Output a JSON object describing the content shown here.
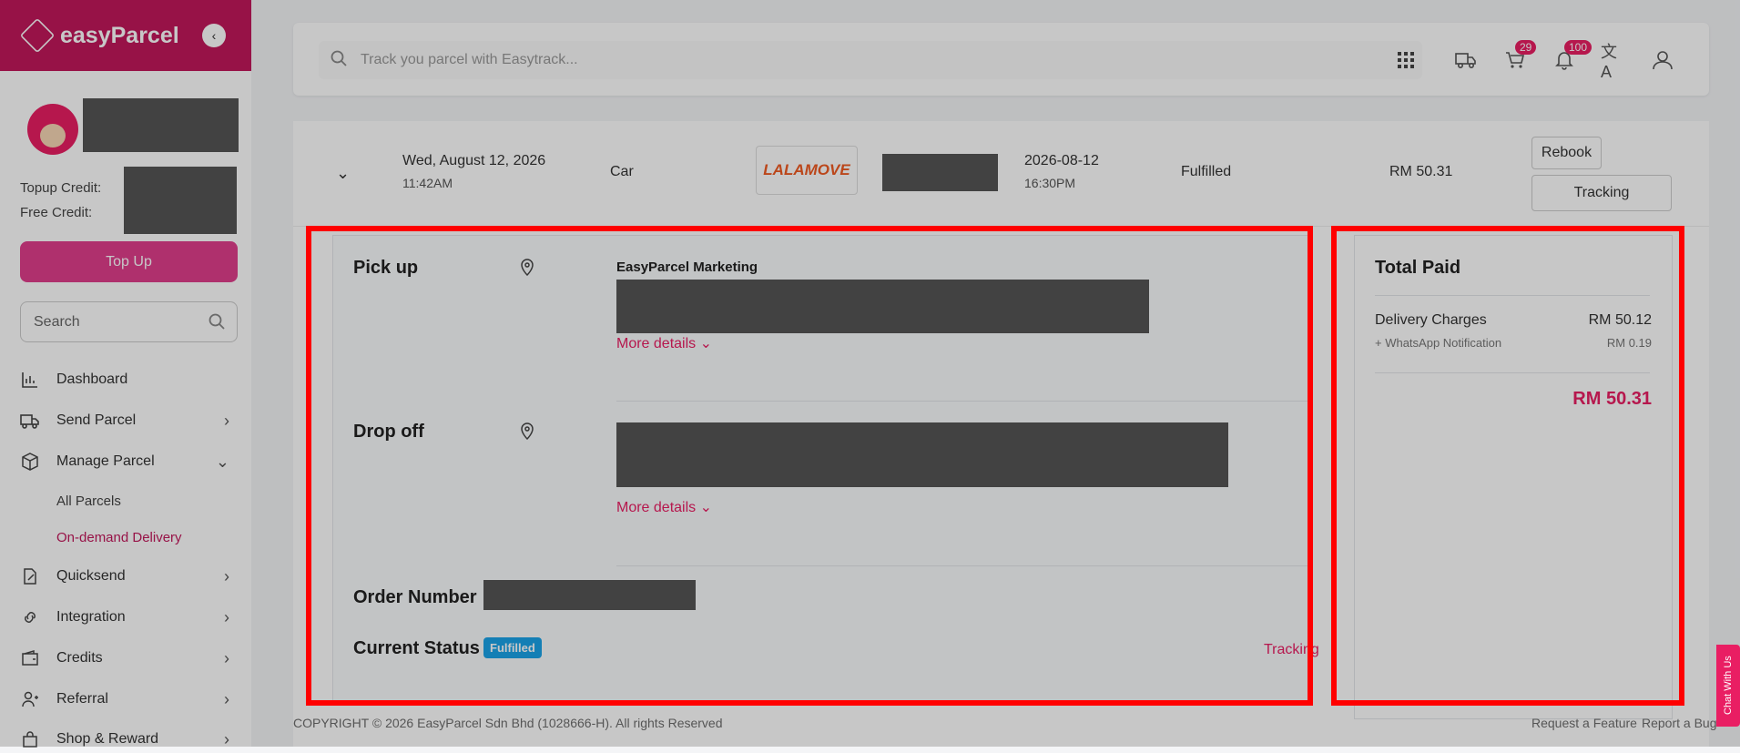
{
  "sidebar": {
    "brand": "easyParcel",
    "credits": {
      "topup_label": "Topup Credit:",
      "free_label": "Free Credit:"
    },
    "topup_button": "Top Up",
    "search_placeholder": "Search",
    "items": [
      {
        "label": "Dashboard",
        "icon": "bar-chart-icon"
      },
      {
        "label": "Send Parcel",
        "icon": "truck-icon"
      },
      {
        "label": "Manage Parcel",
        "icon": "box-icon"
      },
      {
        "label": "Quicksend",
        "icon": "edit-icon"
      },
      {
        "label": "Integration",
        "icon": "link-icon"
      },
      {
        "label": "Credits",
        "icon": "wallet-icon"
      },
      {
        "label": "Referral",
        "icon": "user-plus-icon"
      },
      {
        "label": "Shop & Reward",
        "icon": "bag-icon"
      }
    ],
    "sub_items": [
      {
        "label": "All Parcels"
      },
      {
        "label": "On-demand Delivery",
        "active": true
      }
    ]
  },
  "topbar": {
    "search_placeholder": "Track you parcel with Easytrack...",
    "cart_count": "29",
    "notification_count": "100"
  },
  "order_row": {
    "date": "Wed, August 12, 2026",
    "time": "11:42AM",
    "vehicle": "Car",
    "courier": "LALAMOVE",
    "delivery_date": "2026-08-12",
    "delivery_time": "16:30PM",
    "status": "Fulfilled",
    "amount": "RM 50.31",
    "rebook": "Rebook",
    "tracking": "Tracking"
  },
  "details": {
    "pickup_title": "Pick up",
    "pickup_name": "EasyParcel Marketing",
    "more_details": "More details",
    "dropoff_title": "Drop off",
    "order_number_label": "Order Number :",
    "current_status_label": "Current Status :",
    "current_status": "Fulfilled",
    "tracking_link": "Tracking"
  },
  "payment": {
    "title": "Total Paid",
    "delivery_label": "Delivery Charges",
    "delivery_value": "RM 50.12",
    "whatsapp_label": "+ WhatsApp Notification",
    "whatsapp_value": "RM 0.19",
    "total": "RM 50.31"
  },
  "footer": {
    "copyright": "COPYRIGHT © 2026 EasyParcel Sdn Bhd (1028666-H). All rights Reserved",
    "request_feature": "Request a Feature",
    "report_bug": "Report a Bug"
  },
  "chat_button": "Chat With Us",
  "colors": {
    "brand": "#c2185b",
    "accent": "#e91e63",
    "status": "#1aa3e8",
    "highlight": "#ff0000"
  }
}
